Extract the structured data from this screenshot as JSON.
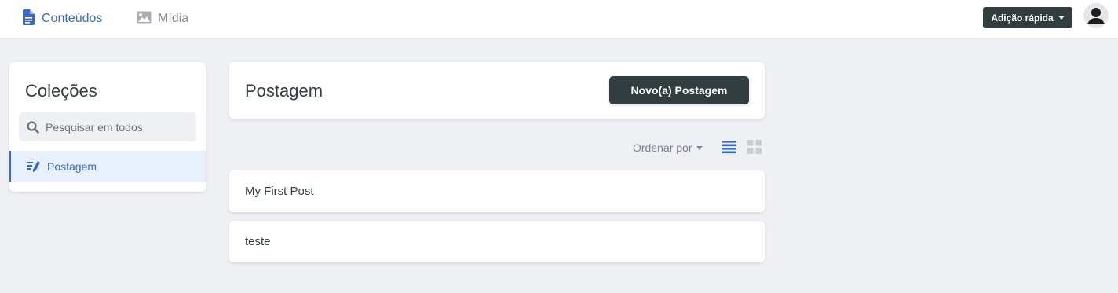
{
  "topbar": {
    "nav": [
      {
        "label": "Conteúdos",
        "icon": "document-icon",
        "active": true
      },
      {
        "label": "Mídia",
        "icon": "image-icon",
        "active": false
      }
    ],
    "quick_add_label": "Adição rápida",
    "avatar_icon": "user-avatar-icon"
  },
  "sidebar": {
    "title": "Coleções",
    "search_placeholder": "Pesquisar em todos",
    "collections": [
      {
        "label": "Postagem",
        "icon": "edit-list-icon",
        "active": true
      }
    ]
  },
  "main": {
    "title": "Postagem",
    "new_button_label": "Novo(a) Postagem",
    "sort_label": "Ordenar por",
    "view_modes": [
      "list-view-icon",
      "grid-view-icon"
    ],
    "active_view": "list",
    "entries": [
      {
        "title": "My First Post"
      },
      {
        "title": "teste"
      }
    ]
  },
  "colors": {
    "accent": "#3a69c7",
    "dark": "#313d3e",
    "background": "#eff0f4",
    "active_item_bg": "#e8f1fb"
  }
}
